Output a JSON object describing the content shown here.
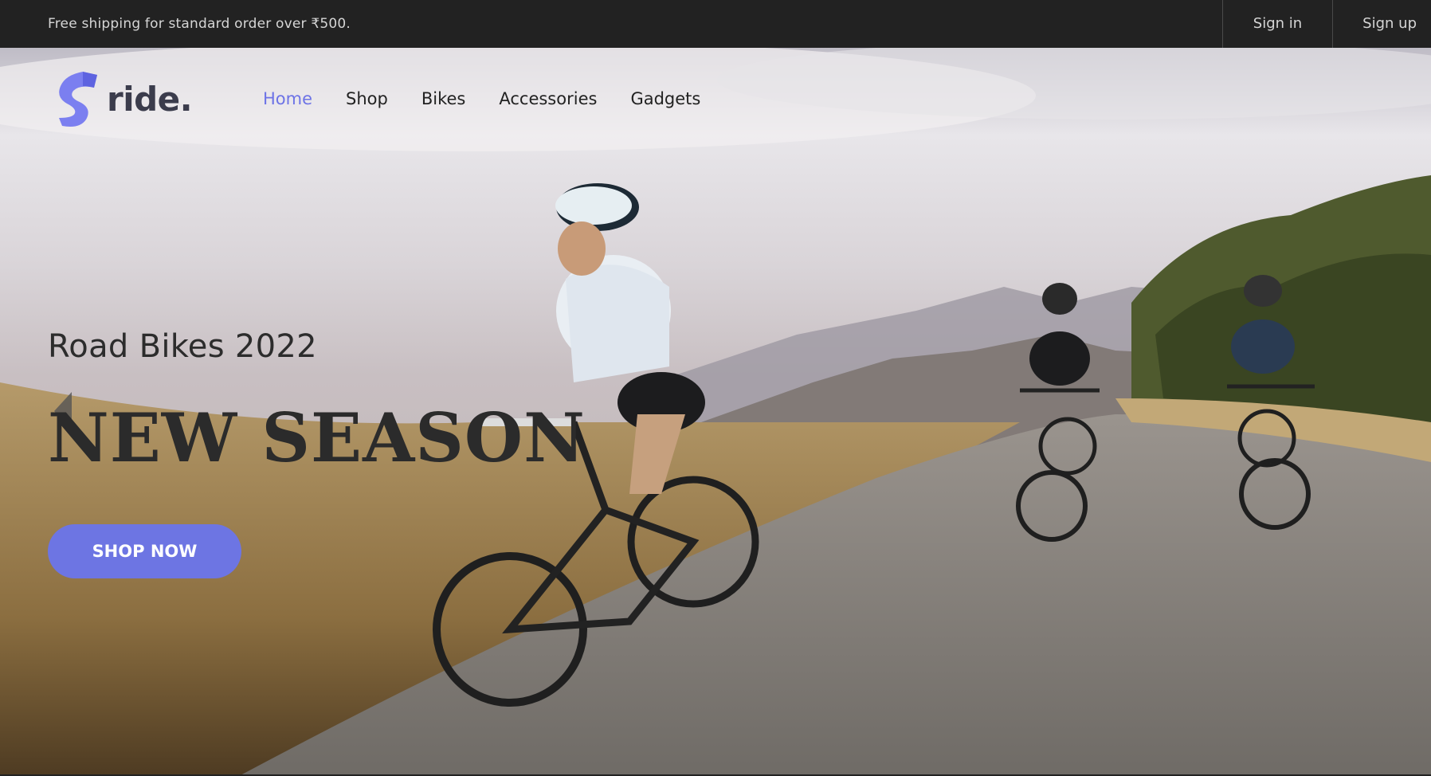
{
  "topbar": {
    "promo": "Free shipping for standard order over ₹500.",
    "sign_in": "Sign in",
    "sign_up": "Sign up"
  },
  "header": {
    "brand": "ride.",
    "nav": [
      {
        "label": "Home",
        "active": true
      },
      {
        "label": "Shop",
        "active": false
      },
      {
        "label": "Bikes",
        "active": false
      },
      {
        "label": "Accessories",
        "active": false
      },
      {
        "label": "Gadgets",
        "active": false
      }
    ]
  },
  "hero": {
    "subtitle": "Road Bikes 2022",
    "headline": "NEW SEASON",
    "cta": "SHOP NOW",
    "image_alt": "cyclists-riding-mountain-road"
  },
  "colors": {
    "accent": "#6d75e3",
    "topbar_bg": "#222222",
    "text_dark": "#2b2b2b"
  },
  "icons": {
    "logo": "ride-logo-icon",
    "prev": "chevron-left-icon"
  }
}
